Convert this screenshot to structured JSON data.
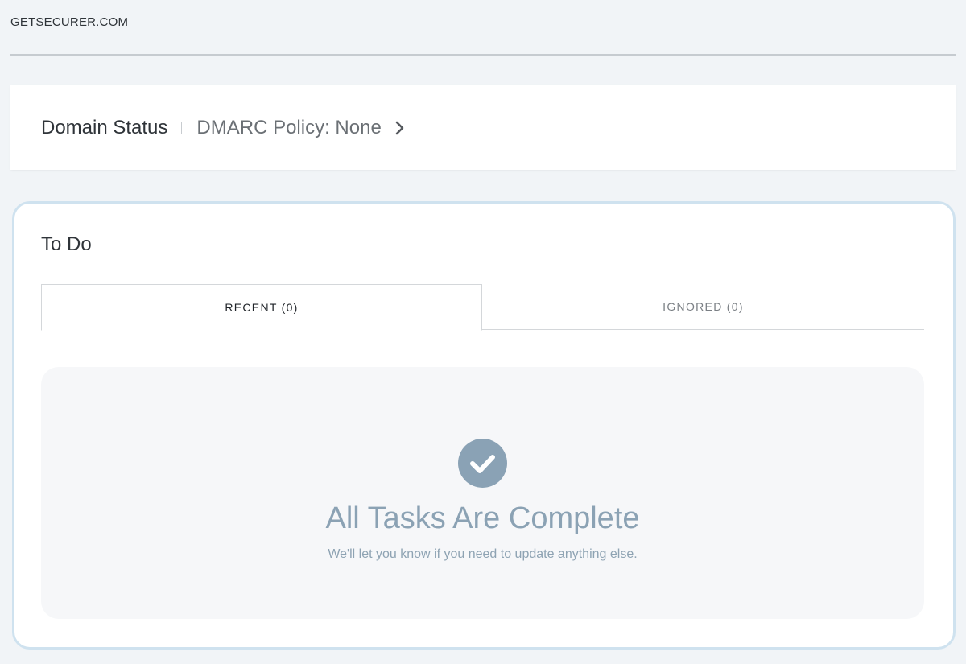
{
  "header": {
    "site_name": "GETSECURER.COM"
  },
  "domain_status": {
    "title": "Domain Status",
    "policy": "DMARC Policy: None",
    "chevron_icon": "chevron-right-icon"
  },
  "todo": {
    "title": "To Do",
    "tabs": [
      {
        "label": "RECENT (0)",
        "active": true
      },
      {
        "label": "IGNORED (0)",
        "active": false
      }
    ],
    "empty_state": {
      "icon": "check-circle-icon",
      "title": "All Tasks Are Complete",
      "subtitle": "We'll let you know if you need to update anything else."
    }
  },
  "colors": {
    "page_background": "#f1f4f7",
    "card_background": "#ffffff",
    "todo_border": "#cfe2ef",
    "empty_accent": "#8aa2b5",
    "empty_panel": "#f6f7f9"
  }
}
